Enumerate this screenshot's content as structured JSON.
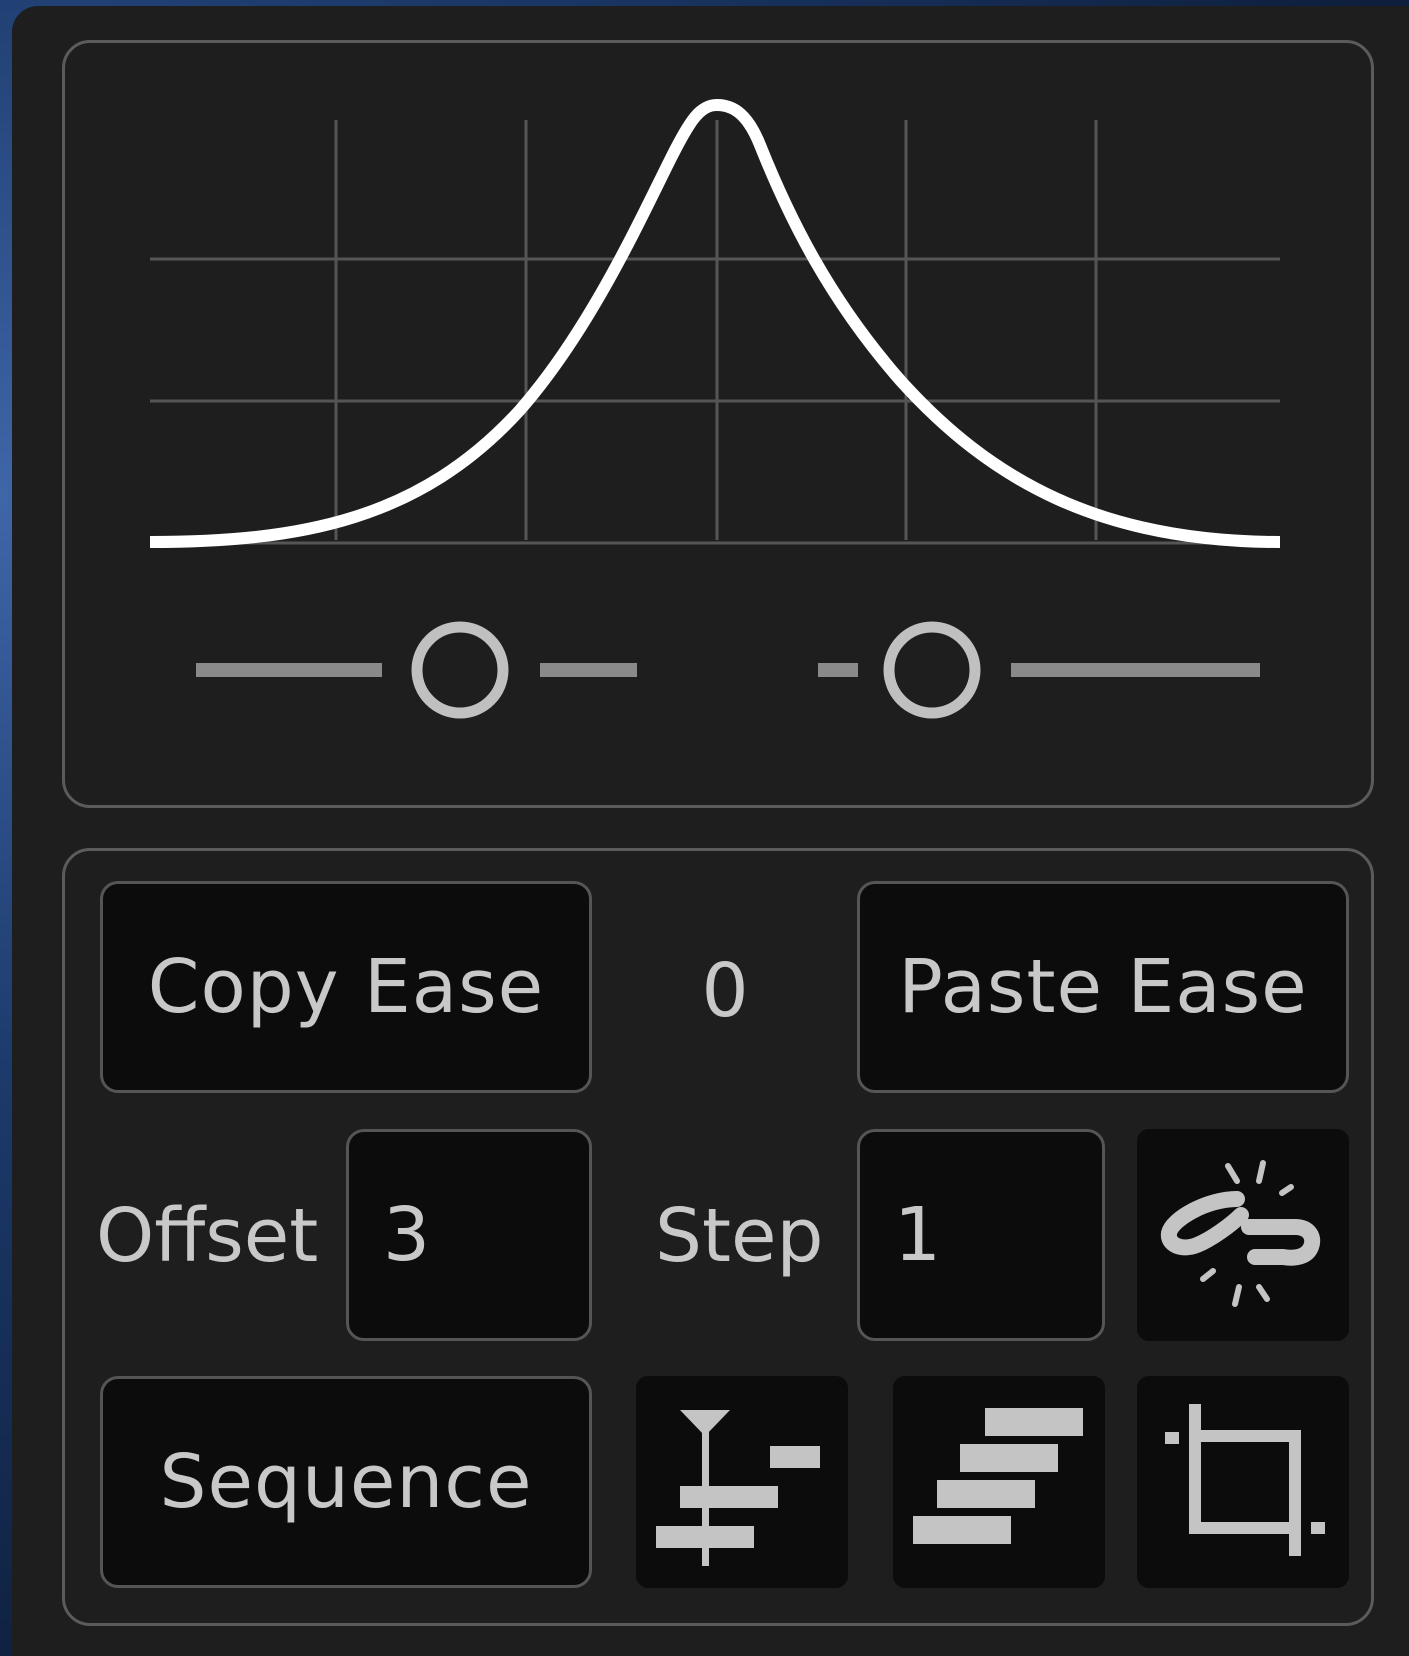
{
  "ease_graph": {
    "curve_shape": "bell",
    "handles": [
      {
        "name": "left-handle",
        "level": 0.6
      },
      {
        "name": "right-handle",
        "level": 0.25
      }
    ]
  },
  "controls": {
    "copy_label": "Copy Ease",
    "paste_label": "Paste Ease",
    "ease_value": "0",
    "offset_label": "Offset",
    "offset_value": "3",
    "step_label": "Step",
    "step_value": "1",
    "sequence_label": "Sequence"
  },
  "icons": {
    "unlink": "unlink-icon",
    "align": "align-to-playhead-icon",
    "stagger": "stagger-icon",
    "crop": "crop-icon"
  },
  "colors": {
    "panel_bg": "#1e1e1e",
    "button_bg": "#0c0c0c",
    "border": "#555555",
    "text": "#c8c8c8",
    "curve": "#ffffff",
    "grid": "#555555"
  }
}
